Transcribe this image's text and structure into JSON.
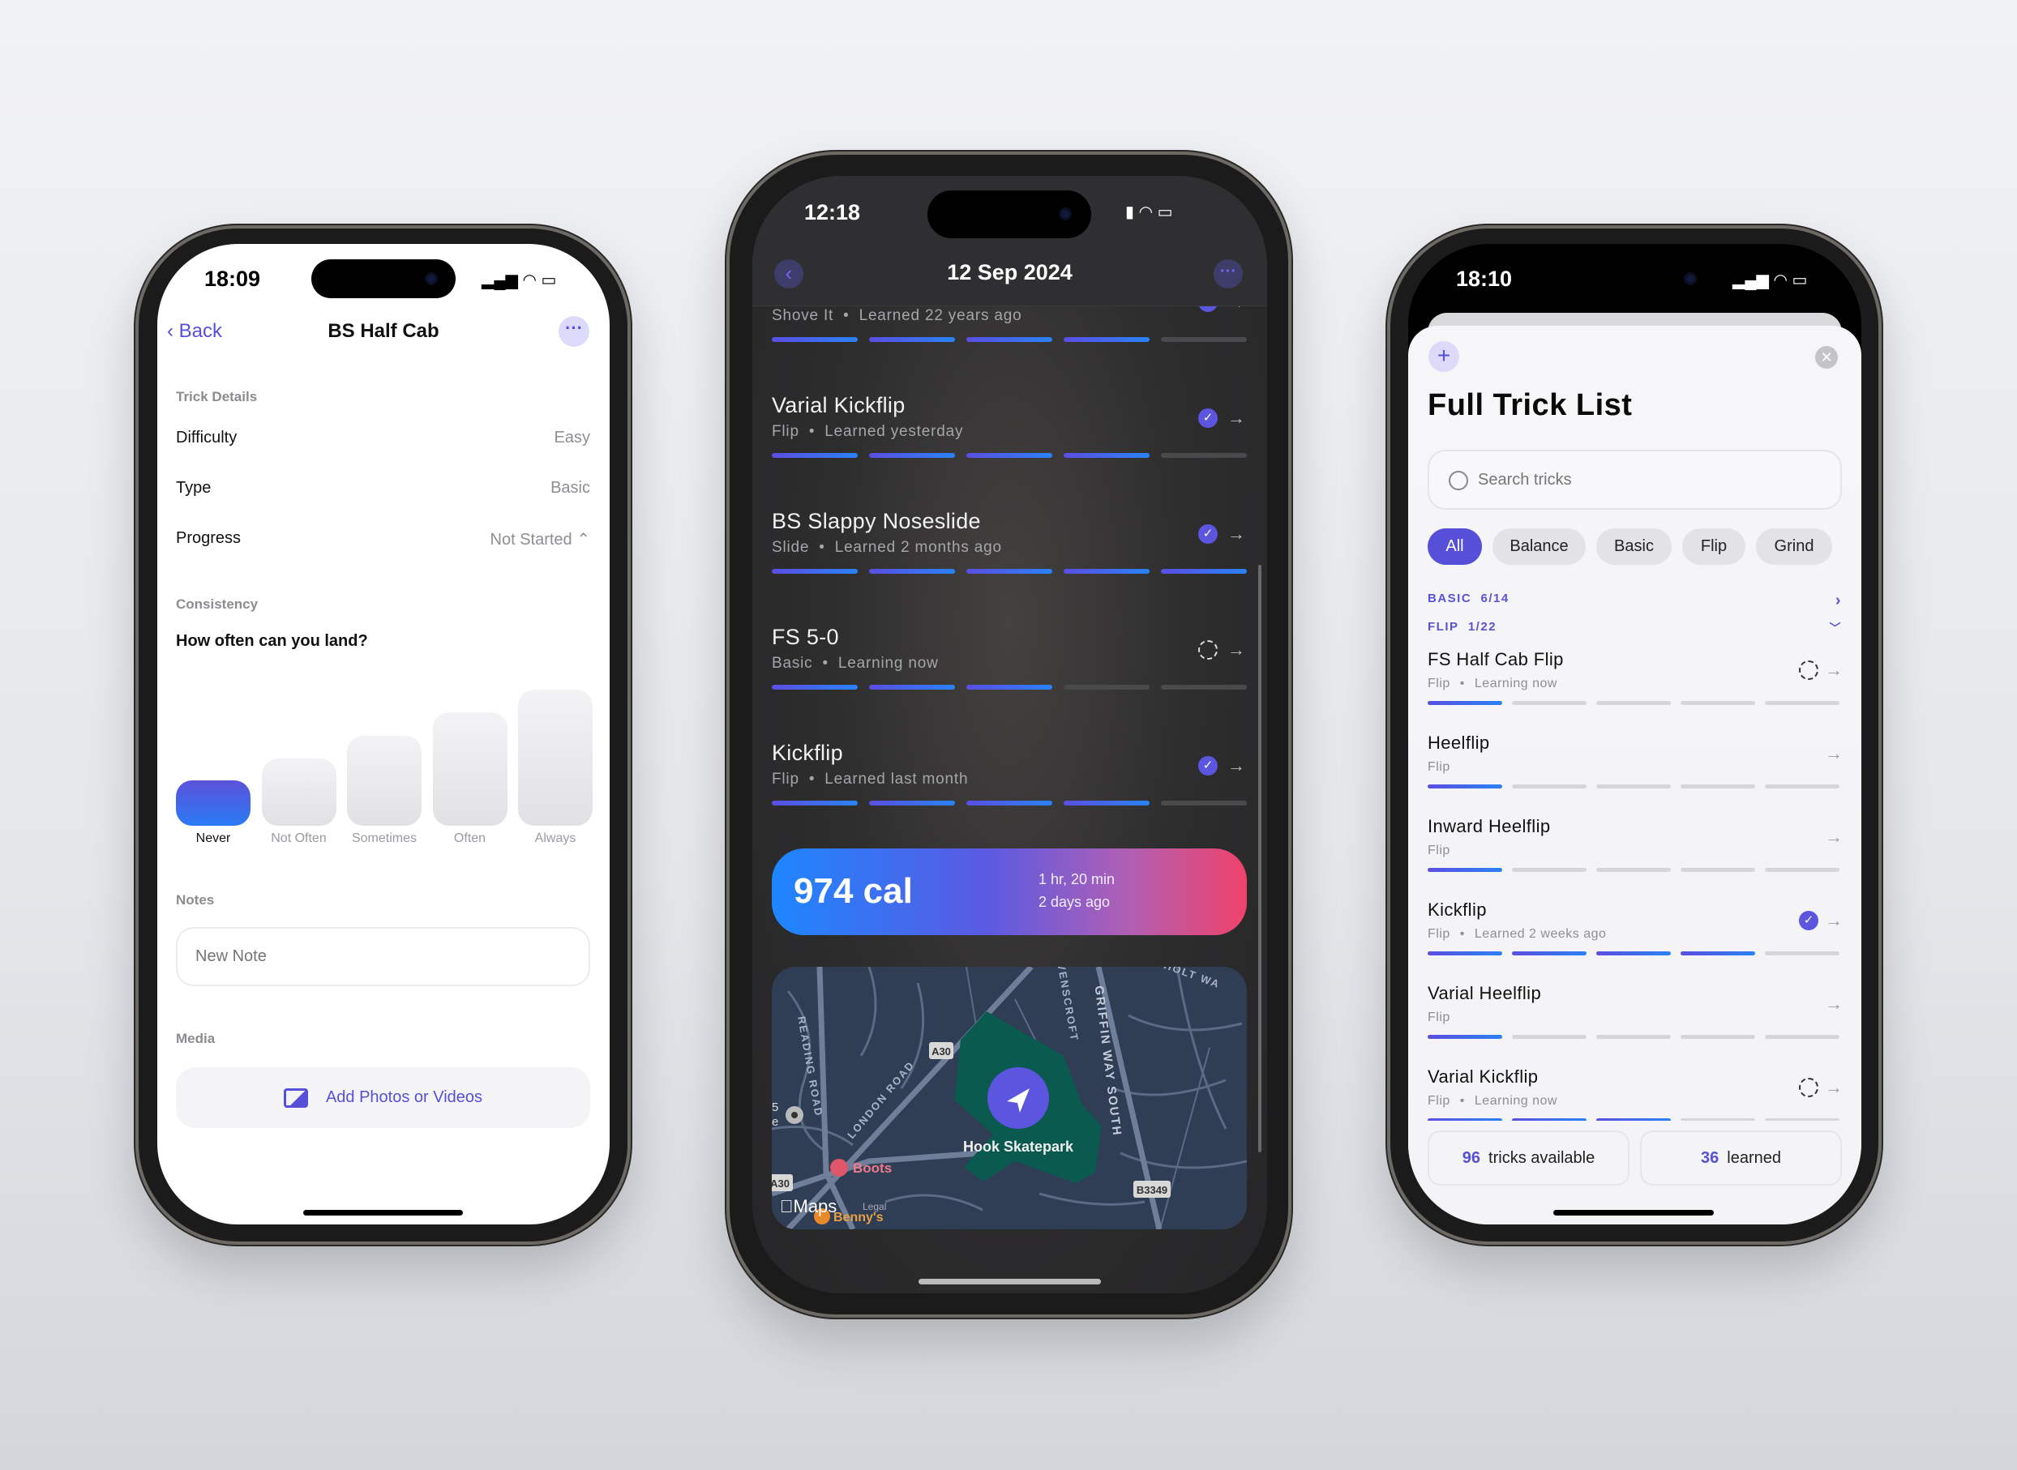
{
  "colors": {
    "accent": "#5650d8",
    "bar_gradient_start": "#5b4ee0",
    "bar_gradient_end": "#2a82f6",
    "calorie_gradient_end": "#f0426a",
    "dark_bg": "#2b2b2d",
    "park": "#0b5a50",
    "map_bg": "#2f3d55"
  },
  "detail": {
    "status_time": "18:09",
    "back_label": "Back",
    "title": "BS Half Cab",
    "section_details": "Trick Details",
    "rows": [
      {
        "label": "Difficulty",
        "value": "Easy"
      },
      {
        "label": "Type",
        "value": "Basic"
      },
      {
        "label": "Progress",
        "value": "Not Started ⌃"
      }
    ],
    "progress_icon": "chevron-up-down-icon",
    "section_consistency": "Consistency",
    "question": "How often can you land?",
    "options": [
      "Never",
      "Not Often",
      "Sometimes",
      "Often",
      "Always"
    ],
    "selected_option": "Never",
    "section_notes": "Notes",
    "note_placeholder": "New Note",
    "section_media": "Media",
    "media_button": "Add Photos or Videos"
  },
  "session": {
    "status_time": "12:18",
    "title": "12 Sep 2024",
    "tricks": [
      {
        "name": "",
        "category": "Shove It",
        "status_text": "Learned 22 years ago",
        "level": 4,
        "status": "check"
      },
      {
        "name": "Varial Kickflip",
        "category": "Flip",
        "status_text": "Learned yesterday",
        "level": 4,
        "status": "check"
      },
      {
        "name": "BS Slappy Noseslide",
        "category": "Slide",
        "status_text": "Learned 2 months ago",
        "level": 5,
        "status": "check"
      },
      {
        "name": "FS 5-0",
        "category": "Basic",
        "status_text": "Learning now",
        "level": 3,
        "status": "learning"
      },
      {
        "name": "Kickflip",
        "category": "Flip",
        "status_text": "Learned last month",
        "level": 4,
        "status": "check"
      }
    ],
    "calories": "974 cal",
    "duration": "1 hr, 20 min",
    "when": "2 days ago",
    "map": {
      "place": "Hook Skatepark",
      "labels": {
        "a30": "A30",
        "a30_left": "A30",
        "b3349": "B3349",
        "london_road": "LONDON ROAD",
        "reading_road": "READING ROAD",
        "ravenscroft": "RAVENSCROFT",
        "griffin": "GRIFFIN WAY SOUTH",
        "holt": "HOLT WA",
        "boots": "Boots",
        "bennys": "Benny's",
        "maps": "Maps",
        "legal": "Legal",
        "edge_5": "5",
        "edge_e": "e"
      }
    }
  },
  "list": {
    "status_time": "18:10",
    "title": "Full Trick List",
    "search_placeholder": "Search tricks",
    "filters": [
      "All",
      "Balance",
      "Basic",
      "Flip",
      "Grind"
    ],
    "active_filter": "All",
    "sections": [
      {
        "name": "BASIC",
        "count": "6/14",
        "expanded": false
      },
      {
        "name": "FLIP",
        "count": "1/22",
        "expanded": true
      }
    ],
    "tricks": [
      {
        "name": "FS Half Cab Flip",
        "category": "Flip",
        "status_text": "Learning now",
        "level": 1,
        "status": "learning"
      },
      {
        "name": "Heelflip",
        "category": "Flip",
        "status_text": "",
        "level": 1,
        "status": "none"
      },
      {
        "name": "Inward Heelflip",
        "category": "Flip",
        "status_text": "",
        "level": 1,
        "status": "none"
      },
      {
        "name": "Kickflip",
        "category": "Flip",
        "status_text": "Learned 2 weeks ago",
        "level": 4,
        "status": "check"
      },
      {
        "name": "Varial Heelflip",
        "category": "Flip",
        "status_text": "",
        "level": 1,
        "status": "none"
      },
      {
        "name": "Varial Kickflip",
        "category": "Flip",
        "status_text": "Learning now",
        "level": 3,
        "status": "learning"
      }
    ],
    "stats": [
      {
        "value": "96",
        "label": "tricks available"
      },
      {
        "value": "36",
        "label": "learned"
      }
    ]
  }
}
